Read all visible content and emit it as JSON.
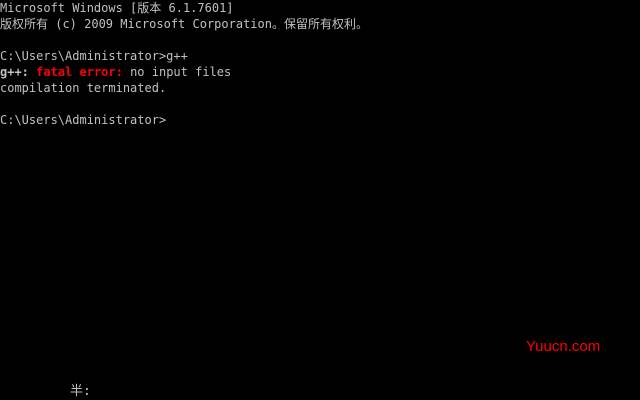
{
  "console": {
    "header_line1": "Microsoft Windows [版本 6.1.7601]",
    "header_line2": "版权所有 (c) 2009 Microsoft Corporation。保留所有权利。",
    "command": {
      "prompt": "C:\\Users\\Administrator>",
      "input": "g++"
    },
    "output_line1": {
      "program": "g++:",
      "error_label": "fatal error:",
      "message": "no input files"
    },
    "output_line2": "compilation terminated.",
    "current_prompt": "C:\\Users\\Administrator>",
    "ime_status": "半:"
  },
  "watermark": "Yuucn.com",
  "colors": {
    "background": "#000000",
    "text": "#c0c0c0",
    "error": "#ff0000",
    "watermark": "#ff0000"
  }
}
